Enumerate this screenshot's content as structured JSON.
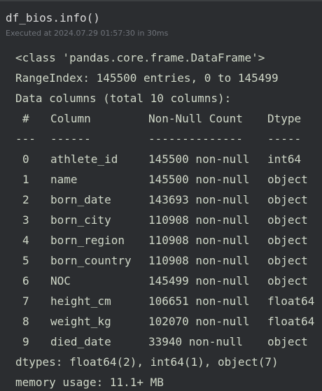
{
  "cell": {
    "code": "df_bios.info()",
    "execution_info": "Executed at 2024.07.29 01:57:30 in 30ms"
  },
  "output": {
    "class_line": "<class 'pandas.core.frame.DataFrame'>",
    "range_index": "RangeIndex: 145500 entries, 0 to 145499",
    "data_columns": "Data columns (total 10 columns):",
    "headers": {
      "num": "#",
      "column": "Column",
      "non_null": "Non-Null Count",
      "dtype": "Dtype"
    },
    "separators": {
      "num": "---",
      "column": "------",
      "non_null": "--------------",
      "dtype": "-----"
    },
    "rows": [
      {
        "num": "0",
        "column": "athlete_id",
        "non_null": "145500 non-null",
        "dtype": "int64"
      },
      {
        "num": "1",
        "column": "name",
        "non_null": "145500 non-null",
        "dtype": "object"
      },
      {
        "num": "2",
        "column": "born_date",
        "non_null": "143693 non-null",
        "dtype": "object"
      },
      {
        "num": "3",
        "column": "born_city",
        "non_null": "110908 non-null",
        "dtype": "object"
      },
      {
        "num": "4",
        "column": "born_region",
        "non_null": "110908 non-null",
        "dtype": "object"
      },
      {
        "num": "5",
        "column": "born_country",
        "non_null": "110908 non-null",
        "dtype": "object"
      },
      {
        "num": "6",
        "column": "NOC",
        "non_null": "145499 non-null",
        "dtype": "object"
      },
      {
        "num": "7",
        "column": "height_cm",
        "non_null": "106651 non-null",
        "dtype": "float64"
      },
      {
        "num": "8",
        "column": "weight_kg",
        "non_null": "102070 non-null",
        "dtype": "float64"
      },
      {
        "num": "9",
        "column": "died_date",
        "non_null": "33940 non-null",
        "dtype": "object"
      }
    ],
    "dtypes_line": "dtypes: float64(2), int64(1), object(7)",
    "memory_line": "memory usage: 11.1+ MB"
  }
}
